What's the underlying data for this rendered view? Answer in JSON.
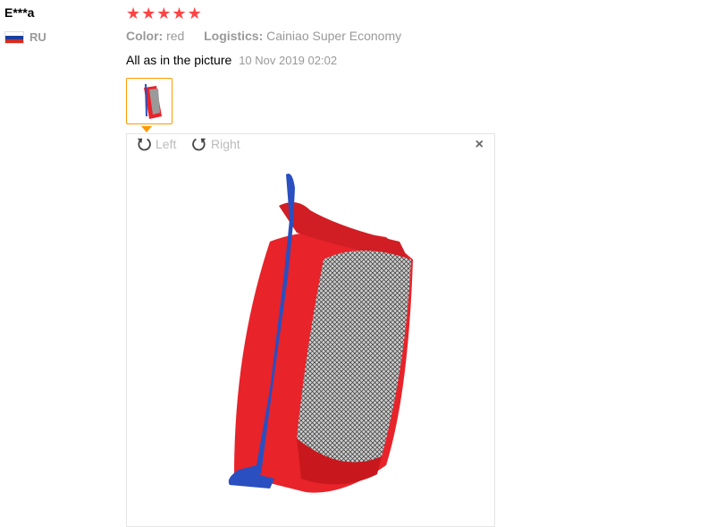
{
  "review": {
    "user_name": "E***a",
    "country_code": "RU",
    "rating": 5,
    "color_label": "Color:",
    "color_value": "red",
    "logistics_label": "Logistics:",
    "logistics_value": "Cainiao Super Economy",
    "feedback_text": "All as in the picture",
    "date": "10 Nov 2019 02:02"
  },
  "viewer": {
    "rotate_left_label": "Left",
    "rotate_right_label": "Right",
    "close_symbol": "×"
  },
  "icons": {
    "flag": "russia-flag-icon",
    "rotate_left": "rotate-left-icon",
    "rotate_right": "rotate-right-icon",
    "close": "close-icon",
    "star": "star-icon"
  },
  "colors": {
    "star": "#ff4444",
    "thumb_border": "#ff9900",
    "muted_text": "#999999",
    "bag_red": "#e8232a",
    "strap_blue": "#2a4fc0"
  }
}
